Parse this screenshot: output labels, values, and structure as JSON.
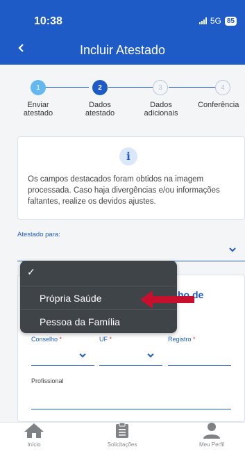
{
  "status": {
    "time": "10:38",
    "network": "5G",
    "battery": "85"
  },
  "nav": {
    "back_icon": "chevron-left-icon",
    "title": "Incluir Atestado"
  },
  "stepper": {
    "steps": [
      {
        "number": "1",
        "label_line1": "Enviar",
        "label_line2": "atestado",
        "state": "done"
      },
      {
        "number": "2",
        "label_line1": "Dados",
        "label_line2": "atestado",
        "state": "active"
      },
      {
        "number": "3",
        "label_line1": "Dados",
        "label_line2": "adicionais",
        "state": "pending"
      },
      {
        "number": "4",
        "label_line1": "Conferência",
        "label_line2": "",
        "state": "pending"
      }
    ]
  },
  "info": {
    "icon": "info-icon",
    "message": "Os campos destacados foram obtidos na imagem processada. Caso haja divergências e/ou informações faltantes, realize os devidos ajustes."
  },
  "form": {
    "atestado_para_label": "Atestado para:",
    "card_title_partial": "ho de",
    "conselho_label": "Conselho",
    "uf_label": "UF",
    "registro_label": "Registro",
    "required_mark": "*",
    "profissional_label": "Profissional"
  },
  "dropdown": {
    "selected_mark": "✓",
    "options": [
      "Própria Saúde",
      "Pessoa da Família"
    ]
  },
  "tabbar": {
    "items": [
      {
        "label": "Início",
        "icon": "home-icon"
      },
      {
        "label": "Solicitações",
        "icon": "clipboard-icon"
      },
      {
        "label": "Meu Perfil",
        "icon": "user-icon"
      }
    ]
  },
  "colors": {
    "primary": "#1e5bc6",
    "menu": "#3f4449",
    "arrow": "#c8102e"
  }
}
